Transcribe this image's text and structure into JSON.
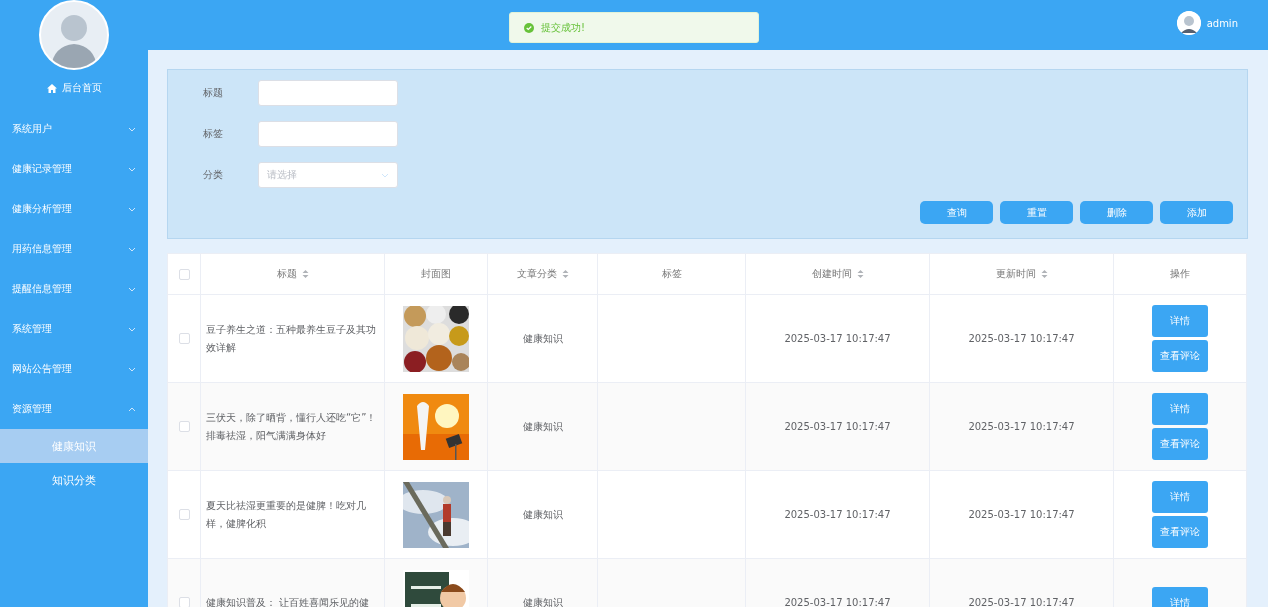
{
  "sidebar": {
    "home": "后台首页",
    "items": [
      {
        "label": "系统用户",
        "expanded": false
      },
      {
        "label": "健康记录管理",
        "expanded": false
      },
      {
        "label": "健康分析管理",
        "expanded": false
      },
      {
        "label": "用药信息管理",
        "expanded": false
      },
      {
        "label": "提醒信息管理",
        "expanded": false
      },
      {
        "label": "系统管理",
        "expanded": false
      },
      {
        "label": "网站公告管理",
        "expanded": false
      },
      {
        "label": "资源管理",
        "expanded": true,
        "children": [
          {
            "label": "健康知识",
            "selected": true
          },
          {
            "label": "知识分类",
            "selected": false
          }
        ]
      }
    ]
  },
  "header": {
    "toast": "提交成功!",
    "user": "admin"
  },
  "search": {
    "fields": [
      {
        "label": "标题",
        "kind": "text"
      },
      {
        "label": "标签",
        "kind": "text"
      },
      {
        "label": "分类",
        "kind": "select",
        "placeholder": "请选择"
      }
    ],
    "buttons": [
      "查询",
      "重置",
      "删除",
      "添加"
    ]
  },
  "table": {
    "select_all": {
      "checked": false
    },
    "columns": [
      {
        "label": "标题",
        "sortable": true
      },
      {
        "label": "封面图",
        "sortable": false
      },
      {
        "label": "文章分类",
        "sortable": true
      },
      {
        "label": "标签",
        "sortable": false
      },
      {
        "label": "创建时间",
        "sortable": true
      },
      {
        "label": "更新时间",
        "sortable": true
      },
      {
        "label": "操作",
        "sortable": false
      }
    ],
    "rows": [
      {
        "checked": false,
        "title": "豆子养生之道：五种最养生豆子及其功效详解",
        "cover": {
          "kind": "picture"
        },
        "category": "健康知识",
        "created": "2025-03-17 10:17:47",
        "updated": "2025-03-17 10:17:47",
        "actions": [
          "详情",
          "查看评论"
        ]
      },
      {
        "checked": false,
        "title": "三伏天，除了晒背，懂行人还吃“它”！排毒祛湿，阳气满满身体好",
        "cover": {
          "kind": "picture"
        },
        "category": "健康知识",
        "created": "2025-03-17 10:17:47",
        "updated": "2025-03-17 10:17:47",
        "actions": [
          "详情",
          "查看评论"
        ]
      },
      {
        "checked": false,
        "title": "夏天比祛湿更重要的是健脾！吃对几样，健脾化积",
        "cover": {
          "kind": "picture"
        },
        "category": "健康知识",
        "created": "2025-03-17 10:17:47",
        "updated": "2025-03-17 10:17:47",
        "actions": [
          "详情",
          "查看评论"
        ]
      },
      {
        "checked": false,
        "title": "健康知识普及： 让百姓喜闻乐见的健",
        "cover": {
          "kind": "picture"
        },
        "category": "健康知识",
        "created": "2025-03-17 10:17:47",
        "updated": "2025-03-17 10:17:47",
        "actions": [
          "详情"
        ]
      }
    ]
  }
}
